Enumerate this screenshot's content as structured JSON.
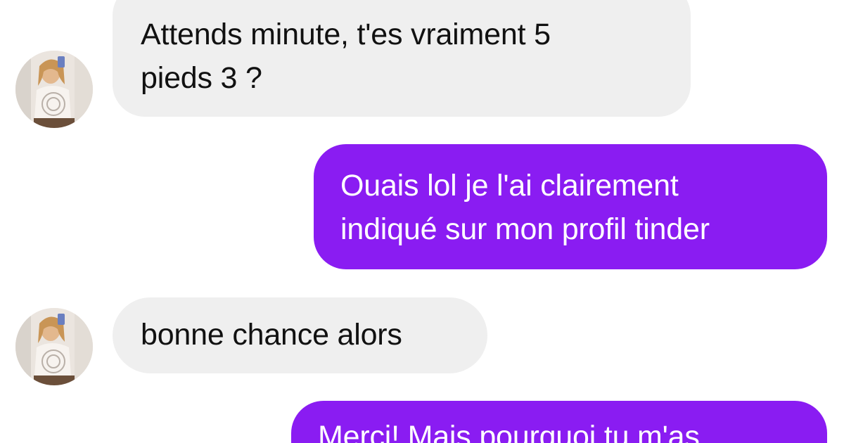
{
  "conversation": {
    "messages": [
      {
        "direction": "incoming",
        "lines": [
          "Attends minute, t'es vraiment 5",
          "pieds 3 ?"
        ],
        "has_avatar": true
      },
      {
        "direction": "outgoing",
        "lines": [
          "Ouais lol je l'ai clairement",
          "indiqué sur mon profil tinder"
        ]
      },
      {
        "direction": "incoming",
        "lines": [
          "bonne chance alors"
        ],
        "has_avatar": true
      },
      {
        "direction": "outgoing",
        "lines": [
          "Merci! Mais pourquoi tu m'as"
        ]
      }
    ]
  },
  "theme": {
    "incoming_bubble_color": "#efefef",
    "outgoing_bubble_color": "#8a1cf2",
    "incoming_text_color": "#111111",
    "outgoing_text_color": "#ffffff"
  },
  "icons": {
    "sender_avatar": "profile-photo-avatar"
  }
}
